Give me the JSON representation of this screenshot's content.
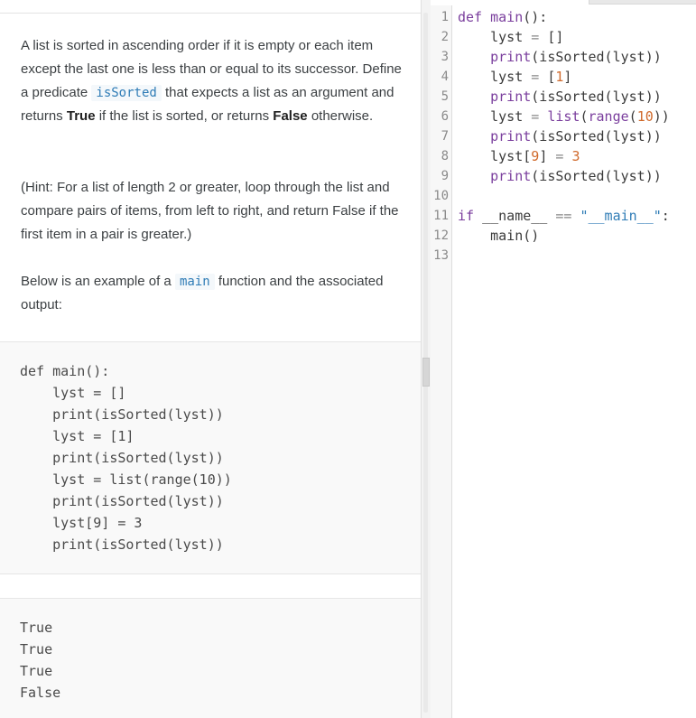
{
  "instructions": {
    "p1_a": "A list is sorted in ascending order if it is empty or each item except the last one is less than or equal to its successor. Define a predicate ",
    "p1_code": "isSorted",
    "p1_b": " that expects a list as an argument and returns ",
    "p1_true": "True",
    "p1_c": " if the list is sorted, or returns ",
    "p1_false": "False",
    "p1_d": " otherwise.",
    "hint": "(Hint: For a list of length 2 or greater, loop through the list and compare pairs of items, from left to right, and return False if the first item in a pair is greater.)",
    "p3_a": "Below is an example of a ",
    "p3_code": "main",
    "p3_b": " function and the associated output:"
  },
  "example_code": [
    "def main():",
    "    lyst = []",
    "    print(isSorted(lyst))",
    "    lyst = [1]",
    "    print(isSorted(lyst))",
    "    lyst = list(range(10))",
    "    print(isSorted(lyst))",
    "    lyst[9] = 3",
    "    print(isSorted(lyst))"
  ],
  "example_output": [
    "True",
    "True",
    "True",
    "False"
  ],
  "editor": {
    "line_numbers": [
      "1",
      "2",
      "3",
      "4",
      "5",
      "6",
      "7",
      "8",
      "9",
      "10",
      "11",
      "12",
      "13"
    ],
    "lines": [
      [
        {
          "t": "def ",
          "c": "kw"
        },
        {
          "t": "main",
          "c": "fn"
        },
        {
          "t": "():",
          "c": ""
        }
      ],
      [
        {
          "t": "    lyst ",
          "c": ""
        },
        {
          "t": "=",
          "c": "op"
        },
        {
          "t": " []",
          "c": ""
        }
      ],
      [
        {
          "t": "    ",
          "c": ""
        },
        {
          "t": "print",
          "c": "fn"
        },
        {
          "t": "(isSorted(lyst))",
          "c": ""
        }
      ],
      [
        {
          "t": "    lyst ",
          "c": ""
        },
        {
          "t": "=",
          "c": "op"
        },
        {
          "t": " [",
          "c": ""
        },
        {
          "t": "1",
          "c": "nm"
        },
        {
          "t": "]",
          "c": ""
        }
      ],
      [
        {
          "t": "    ",
          "c": ""
        },
        {
          "t": "print",
          "c": "fn"
        },
        {
          "t": "(isSorted(lyst))",
          "c": ""
        }
      ],
      [
        {
          "t": "    lyst ",
          "c": ""
        },
        {
          "t": "=",
          "c": "op"
        },
        {
          "t": " ",
          "c": ""
        },
        {
          "t": "list",
          "c": "fn"
        },
        {
          "t": "(",
          "c": ""
        },
        {
          "t": "range",
          "c": "fn"
        },
        {
          "t": "(",
          "c": ""
        },
        {
          "t": "10",
          "c": "nm"
        },
        {
          "t": "))",
          "c": ""
        }
      ],
      [
        {
          "t": "    ",
          "c": ""
        },
        {
          "t": "print",
          "c": "fn"
        },
        {
          "t": "(isSorted(lyst))",
          "c": ""
        }
      ],
      [
        {
          "t": "    lyst[",
          "c": ""
        },
        {
          "t": "9",
          "c": "nm"
        },
        {
          "t": "] ",
          "c": ""
        },
        {
          "t": "=",
          "c": "op"
        },
        {
          "t": " ",
          "c": ""
        },
        {
          "t": "3",
          "c": "nm"
        }
      ],
      [
        {
          "t": "    ",
          "c": ""
        },
        {
          "t": "print",
          "c": "fn"
        },
        {
          "t": "(isSorted(lyst))",
          "c": ""
        }
      ],
      [],
      [
        {
          "t": "if ",
          "c": "kw"
        },
        {
          "t": "__name__ ",
          "c": ""
        },
        {
          "t": "==",
          "c": "op"
        },
        {
          "t": " ",
          "c": ""
        },
        {
          "t": "\"__main__\"",
          "c": "st"
        },
        {
          "t": ":",
          "c": ""
        }
      ],
      [
        {
          "t": "    main()",
          "c": ""
        }
      ],
      []
    ]
  },
  "colors": {
    "keyword": "#7a3e9d",
    "number": "#d06a2c",
    "string": "#2f7cb6",
    "inline_code": "#2f7cb6"
  }
}
